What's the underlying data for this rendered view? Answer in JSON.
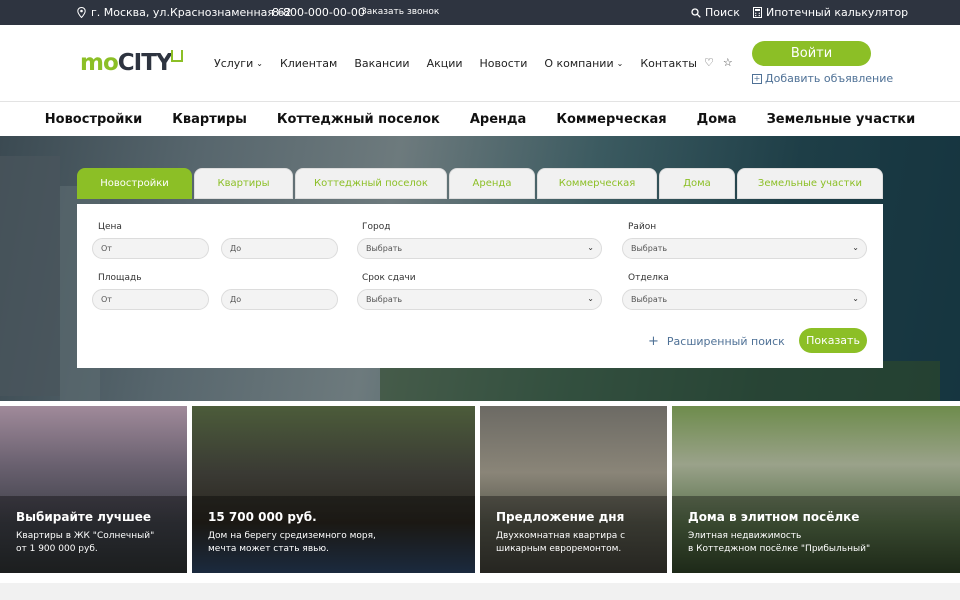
{
  "topbar": {
    "address": "г. Москва, ул.Краснознаменная 62",
    "phone": "8-800-000-00-00",
    "callback": "Заказать звонок",
    "search": "Поиск",
    "calculator": "Ипотечный калькулятор"
  },
  "header": {
    "logo_mo": "mo",
    "logo_city": "CITY",
    "nav": [
      "Услуги",
      "Клиентам",
      "Вакансии",
      "Акции",
      "Новости",
      "О компании",
      "Контакты"
    ],
    "login": "Войти",
    "add_ad": "Добавить объявление"
  },
  "categories": [
    "Новостройки",
    "Квартиры",
    "Коттеджный поселок",
    "Аренда",
    "Коммерческая",
    "Дома",
    "Земельные участки"
  ],
  "search": {
    "tabs": [
      "Новостройки",
      "Квартиры",
      "Коттеджный поселок",
      "Аренда",
      "Коммерческая",
      "Дома",
      "Земельные участки"
    ],
    "price_label": "Цена",
    "area_label": "Площадь",
    "city_label": "Город",
    "term_label": "Срок сдачи",
    "district_label": "Район",
    "finish_label": "Отделка",
    "from": "От",
    "to": "До",
    "select": "Выбрать",
    "advanced": "Расширенный поиск",
    "show": "Показать"
  },
  "promos": [
    {
      "title": "Выбирайте лучшее",
      "desc1": "Квартиры в ЖК \"Солнечный\"",
      "desc2": "от 1 900 000 руб."
    },
    {
      "title": "15 700 000 руб.",
      "desc1": "Дом на берегу средиземного моря,",
      "desc2": "мечта может стать явью."
    },
    {
      "title": "Предложение дня",
      "desc1": "Двухкомнатная квартира с",
      "desc2": "шикарным евроремонтом."
    },
    {
      "title": "Дома в элитном посёлке",
      "desc1": "Элитная недвижимость",
      "desc2": "в Коттеджном посёлке \"Прибыльный\""
    }
  ],
  "colors": {
    "accent": "#8cbf26",
    "topbar": "#2e3440",
    "link": "#4f7196"
  }
}
